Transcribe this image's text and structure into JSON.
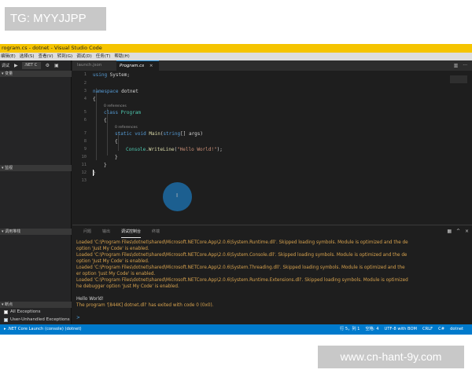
{
  "watermarks": {
    "top": "TG: MYYJJPP",
    "bottom": "www.cn-hant-9y.com"
  },
  "window": {
    "title": "rogram.cs - dotnet - Visual Studio Code"
  },
  "menu": [
    "编辑(E)",
    "选择(S)",
    "查看(V)",
    "转到(G)",
    "调试(D)",
    "任务(T)",
    "帮助(H)"
  ],
  "sidebar": {
    "debug_label": "调试",
    "config": ".NET C",
    "sections": {
      "variables": "变量",
      "watch": "监视",
      "callstack": "调用堆栈",
      "breakpoints": "断点"
    },
    "exceptions": [
      {
        "label": "All Exceptions",
        "checked": false
      },
      {
        "label": "User-Unhandled Exceptions",
        "checked": true
      }
    ]
  },
  "tabs": [
    {
      "label": "launch.json",
      "active": false
    },
    {
      "label": "Program.cs",
      "active": true,
      "close": "×"
    }
  ],
  "editor": {
    "line_numbers": [
      "1",
      "2",
      "3",
      "4",
      "5",
      "6",
      "7",
      "8",
      "9",
      "10",
      "11",
      "12",
      "13"
    ],
    "code": {
      "l1_kw": "using",
      "l1_rest": " System;",
      "l3_kw": "namespace",
      "l3_rest": " dotnet",
      "open": "{",
      "close": "}",
      "class_kw": "class",
      "class_name": " Program",
      "method_kw": "static void",
      "method_name": " Main",
      "method_p1": "(",
      "method_type": "string",
      "method_rest": "[] args)",
      "call_obj": "Console",
      "call_dot": ".",
      "call_fn": "WriteLine",
      "call_p1": "(",
      "call_str": "\"Hello World!\"",
      "call_end": ");"
    },
    "codelens": "0 references"
  },
  "panel": {
    "tabs": [
      "问题",
      "输出",
      "调试控制台",
      "终端"
    ],
    "active_tab": "调试控制台",
    "output_lines": [
      "Loaded 'C:\\Program Files\\dotnet\\shared\\Microsoft.NETCore.App\\2.0.6\\System.Runtime.dll'. Skipped loading symbols. Module is optimized and the de",
      " option 'Just My Code' is enabled.",
      "Loaded 'C:\\Program Files\\dotnet\\shared\\Microsoft.NETCore.App\\2.0.6\\System.Console.dll'. Skipped loading symbols. Module is optimized and the de",
      " option 'Just My Code' is enabled.",
      "Loaded 'C:\\Program Files\\dotnet\\shared\\Microsoft.NETCore.App\\2.0.6\\System.Threading.dll'. Skipped loading symbols. Module is optimized and the",
      "er option 'Just My Code' is enabled.",
      "Loaded 'C:\\Program Files\\dotnet\\shared\\Microsoft.NETCore.App\\2.0.6\\System.Runtime.Extensions.dll'. Skipped loading symbols. Module is optimized",
      "he debugger option 'Just My Code' is enabled."
    ],
    "hello": "Hello World!",
    "exit_line": "The program '[844K] dotnet.dll' has exited with code 0 (0x0).",
    "prompt": ">"
  },
  "status": {
    "left": "▸ .NET Core Launch (console) (dotnet)",
    "right": [
      "行 5，列 1",
      "空格: 4",
      "UTF-8 with BOM",
      "CRLF",
      "C#",
      "dotnet"
    ]
  },
  "colors": {
    "titlebar": "#f5c400",
    "statusbar": "#007acc",
    "editor_bg": "#1e1e1e",
    "output": "#d7a24e"
  }
}
